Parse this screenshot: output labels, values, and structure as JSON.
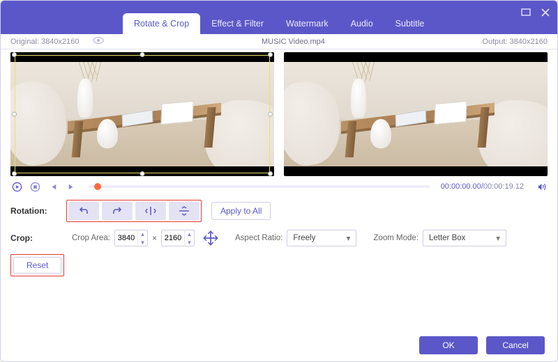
{
  "window": {
    "tabs": [
      {
        "label": "Rotate & Crop",
        "active": true
      },
      {
        "label": "Effect & Filter",
        "active": false
      },
      {
        "label": "Watermark",
        "active": false
      },
      {
        "label": "Audio",
        "active": false
      },
      {
        "label": "Subtitle",
        "active": false
      }
    ],
    "minimize_tooltip": "Minimize",
    "close_tooltip": "Close"
  },
  "info": {
    "original_label": "Original: 3840x2160",
    "filename": "MUSIC Video.mp4",
    "output_label": "Output: 3840x2160"
  },
  "playback": {
    "current": "00:00:00.00",
    "separator": "/",
    "duration": "00:00:19.12"
  },
  "rotation": {
    "label": "Rotation:",
    "apply_all_label": "Apply to All",
    "buttons": [
      "rotate-left",
      "rotate-right",
      "flip-horizontal",
      "flip-vertical"
    ]
  },
  "crop": {
    "label": "Crop:",
    "area_label": "Crop Area:",
    "width": "3840",
    "height": "2160",
    "times": "×",
    "aspect_ratio_label": "Aspect Ratio:",
    "aspect_ratio_value": "Freely",
    "zoom_mode_label": "Zoom Mode:",
    "zoom_mode_value": "Letter Box",
    "reset_label": "Reset"
  },
  "footer": {
    "ok": "OK",
    "cancel": "Cancel"
  },
  "colors": {
    "accent": "#5b57c8",
    "highlight": "#e33b2e"
  }
}
